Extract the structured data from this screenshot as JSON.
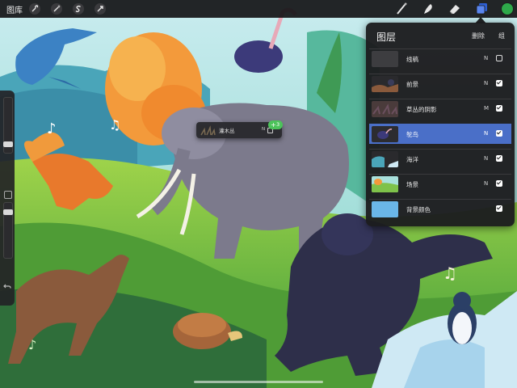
{
  "topbar": {
    "gallery_label": "图库"
  },
  "tools_left": [
    "wrench-icon",
    "magic-wand-icon",
    "s-selection-icon",
    "transform-arrow-icon"
  ],
  "tools_right": [
    "brush-icon",
    "smudge-icon",
    "eraser-icon",
    "layers-icon",
    "color-icon"
  ],
  "colors": {
    "accent": "#4a6fc8",
    "current_color": "#2ea84a",
    "panel_bg": "#1c1c1e",
    "badge": "#4cc35a"
  },
  "layers_panel": {
    "title": "图层",
    "delete_label": "删除",
    "group_label": "组",
    "layers": [
      {
        "name": "线稿",
        "mode": "N",
        "visible": false,
        "selected": false
      },
      {
        "name": "前景",
        "mode": "N",
        "visible": true,
        "selected": false
      },
      {
        "name": "草丛的阴影",
        "mode": "M",
        "visible": true,
        "selected": false
      },
      {
        "name": "鸵鸟",
        "mode": "N",
        "visible": true,
        "selected": true
      },
      {
        "name": "海洋",
        "mode": "N",
        "visible": true,
        "selected": false
      },
      {
        "name": "场景",
        "mode": "N",
        "visible": true,
        "selected": false
      },
      {
        "name": "背景颜色",
        "mode": "",
        "visible": true,
        "selected": false
      }
    ]
  },
  "drag_chip": {
    "label": "灌木丛",
    "mode": "N",
    "badge_plus": "+",
    "badge_count": "3"
  }
}
